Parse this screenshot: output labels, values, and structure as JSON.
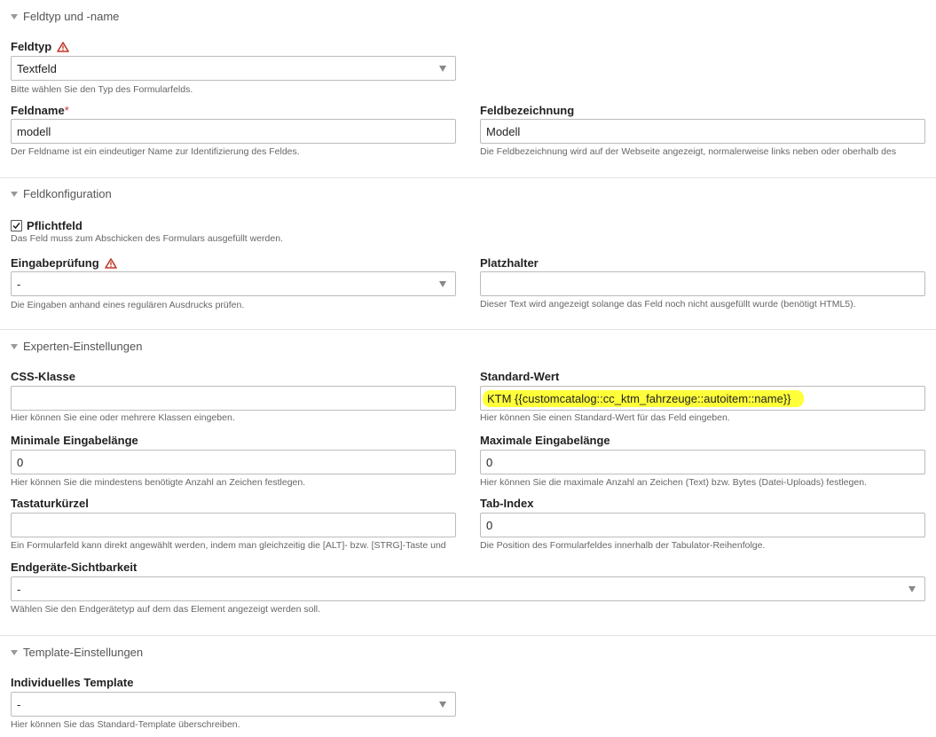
{
  "sections": {
    "s1": "Feldtyp und -name",
    "s2": "Feldkonfiguration",
    "s3": "Experten-Einstellungen",
    "s4": "Template-Einstellungen"
  },
  "feldtyp": {
    "label": "Feldtyp",
    "value": "Textfeld",
    "help": "Bitte wählen Sie den Typ des Formularfelds."
  },
  "feldname": {
    "label": "Feldname",
    "required_mark": "*",
    "value": "modell",
    "help": "Der Feldname ist ein eindeutiger Name zur Identifizierung des Feldes."
  },
  "feldbezeichnung": {
    "label": "Feldbezeichnung",
    "value": "Modell",
    "help": "Die Feldbezeichnung wird auf der Webseite angezeigt, normalerweise links neben oder oberhalb des"
  },
  "pflichtfeld": {
    "label": "Pflichtfeld",
    "checked": true,
    "help": "Das Feld muss zum Abschicken des Formulars ausgefüllt werden."
  },
  "eingabepruefung": {
    "label": "Eingabeprüfung",
    "value": "-",
    "help": "Die Eingaben anhand eines regulären Ausdrucks prüfen."
  },
  "platzhalter": {
    "label": "Platzhalter",
    "value": "",
    "help": "Dieser Text wird angezeigt solange das Feld noch nicht ausgefüllt wurde (benötigt HTML5)."
  },
  "css_klasse": {
    "label": "CSS-Klasse",
    "value": "",
    "help": "Hier können Sie eine oder mehrere Klassen eingeben."
  },
  "standard_wert": {
    "label": "Standard-Wert",
    "value": "KTM {{customcatalog::cc_ktm_fahrzeuge::autoitem::name}}",
    "help": "Hier können Sie einen Standard-Wert für das Feld eingeben."
  },
  "min_laenge": {
    "label": "Minimale Eingabelänge",
    "value": "0",
    "help": "Hier können Sie die mindestens benötigte Anzahl an Zeichen festlegen."
  },
  "max_laenge": {
    "label": "Maximale Eingabelänge",
    "value": "0",
    "help": "Hier können Sie die maximale Anzahl an Zeichen (Text) bzw. Bytes (Datei-Uploads) festlegen."
  },
  "tastaturkuerzel": {
    "label": "Tastaturkürzel",
    "value": "",
    "help": "Ein Formularfeld kann direkt angewählt werden, indem man gleichzeitig die [ALT]- bzw. [STRG]-Taste und"
  },
  "tab_index": {
    "label": "Tab-Index",
    "value": "0",
    "help": "Die Position des Formularfeldes innerhalb der Tabulator-Reihenfolge."
  },
  "sichtbarkeit": {
    "label": "Endgeräte-Sichtbarkeit",
    "value": "-",
    "help": "Wählen Sie den Endgerätetyp auf dem das Element angezeigt werden soll."
  },
  "template": {
    "label": "Individuelles Template",
    "value": "-",
    "help": "Hier können Sie das Standard-Template überschreiben."
  },
  "icons": {
    "warning": "warning-triangle-icon",
    "collapse": "collapse-arrow-icon",
    "dropdown": "chevron-down-icon"
  },
  "colors": {
    "highlight": "#ffff3a",
    "warning": "#c0392b",
    "required": "#cc3333"
  }
}
